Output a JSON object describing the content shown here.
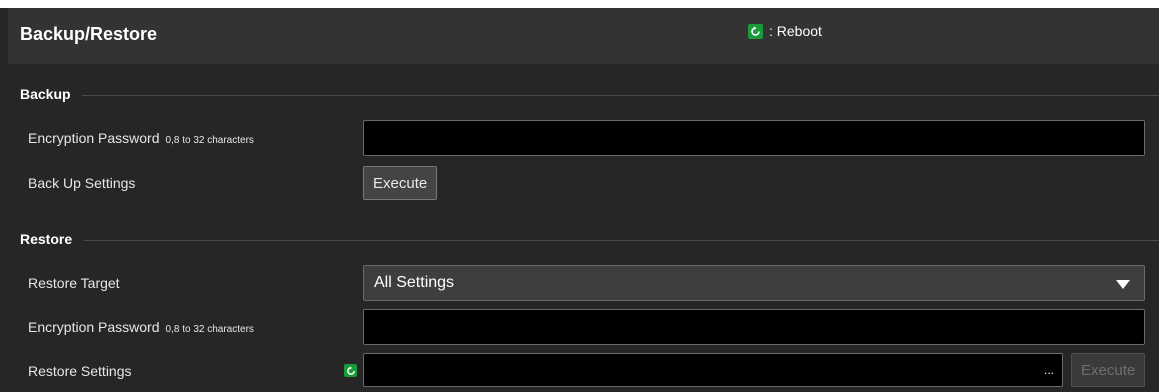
{
  "header": {
    "title": "Backup/Restore",
    "reboot_legend": ": Reboot",
    "reboot_icon": "reboot-icon"
  },
  "backup": {
    "title": "Backup",
    "encryption_password": {
      "label": "Encryption Password",
      "hint": "0,8 to 32 characters",
      "value": ""
    },
    "back_up_settings": {
      "label": "Back Up Settings",
      "button": "Execute"
    }
  },
  "restore": {
    "title": "Restore",
    "restore_target": {
      "label": "Restore Target",
      "selected": "All Settings"
    },
    "encryption_password": {
      "label": "Encryption Password",
      "hint": "0,8 to 32 characters",
      "value": ""
    },
    "restore_settings": {
      "label": "Restore Settings",
      "file_value": "",
      "browse": "...",
      "button": "Execute",
      "requires_reboot": true
    }
  },
  "colors": {
    "background": "#262626",
    "header": "#333333",
    "reboot_green": "#1a9a3a"
  }
}
